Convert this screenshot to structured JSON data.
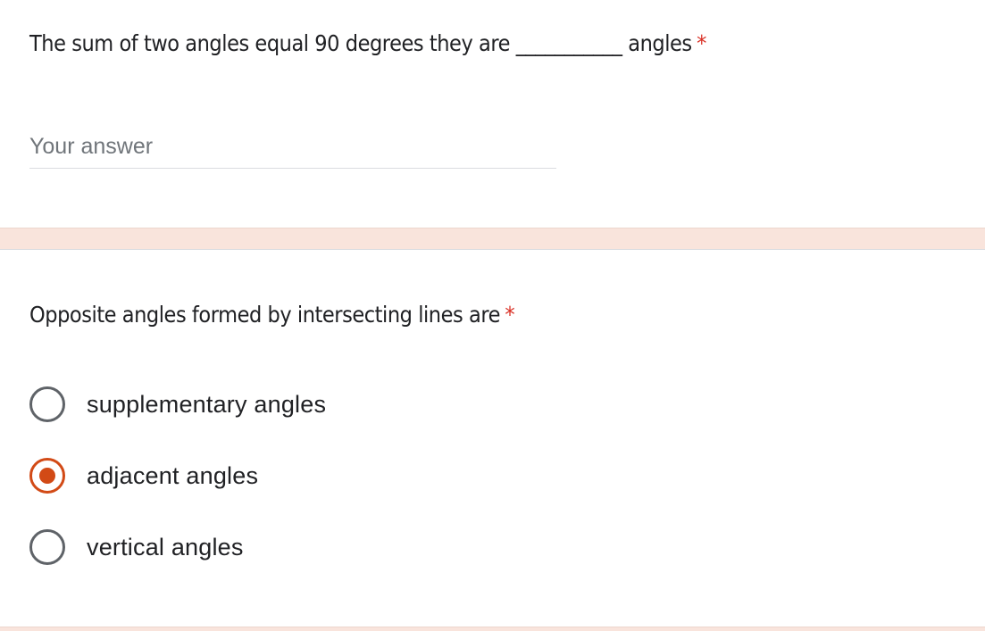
{
  "questions": [
    {
      "title": "The sum of two angles equal 90 degrees they are ___________ angles",
      "required_marker": "*",
      "answer": {
        "value": "",
        "placeholder": "Your answer"
      }
    },
    {
      "title": "Opposite angles formed by intersecting lines are",
      "required_marker": "*",
      "options": [
        {
          "label": "supplementary angles",
          "selected": false
        },
        {
          "label": "adjacent angles",
          "selected": true
        },
        {
          "label": "vertical angles",
          "selected": false
        }
      ]
    }
  ],
  "colors": {
    "accent": "#d24a16",
    "required": "#d93025",
    "section_gap": "#f9e4dc"
  }
}
